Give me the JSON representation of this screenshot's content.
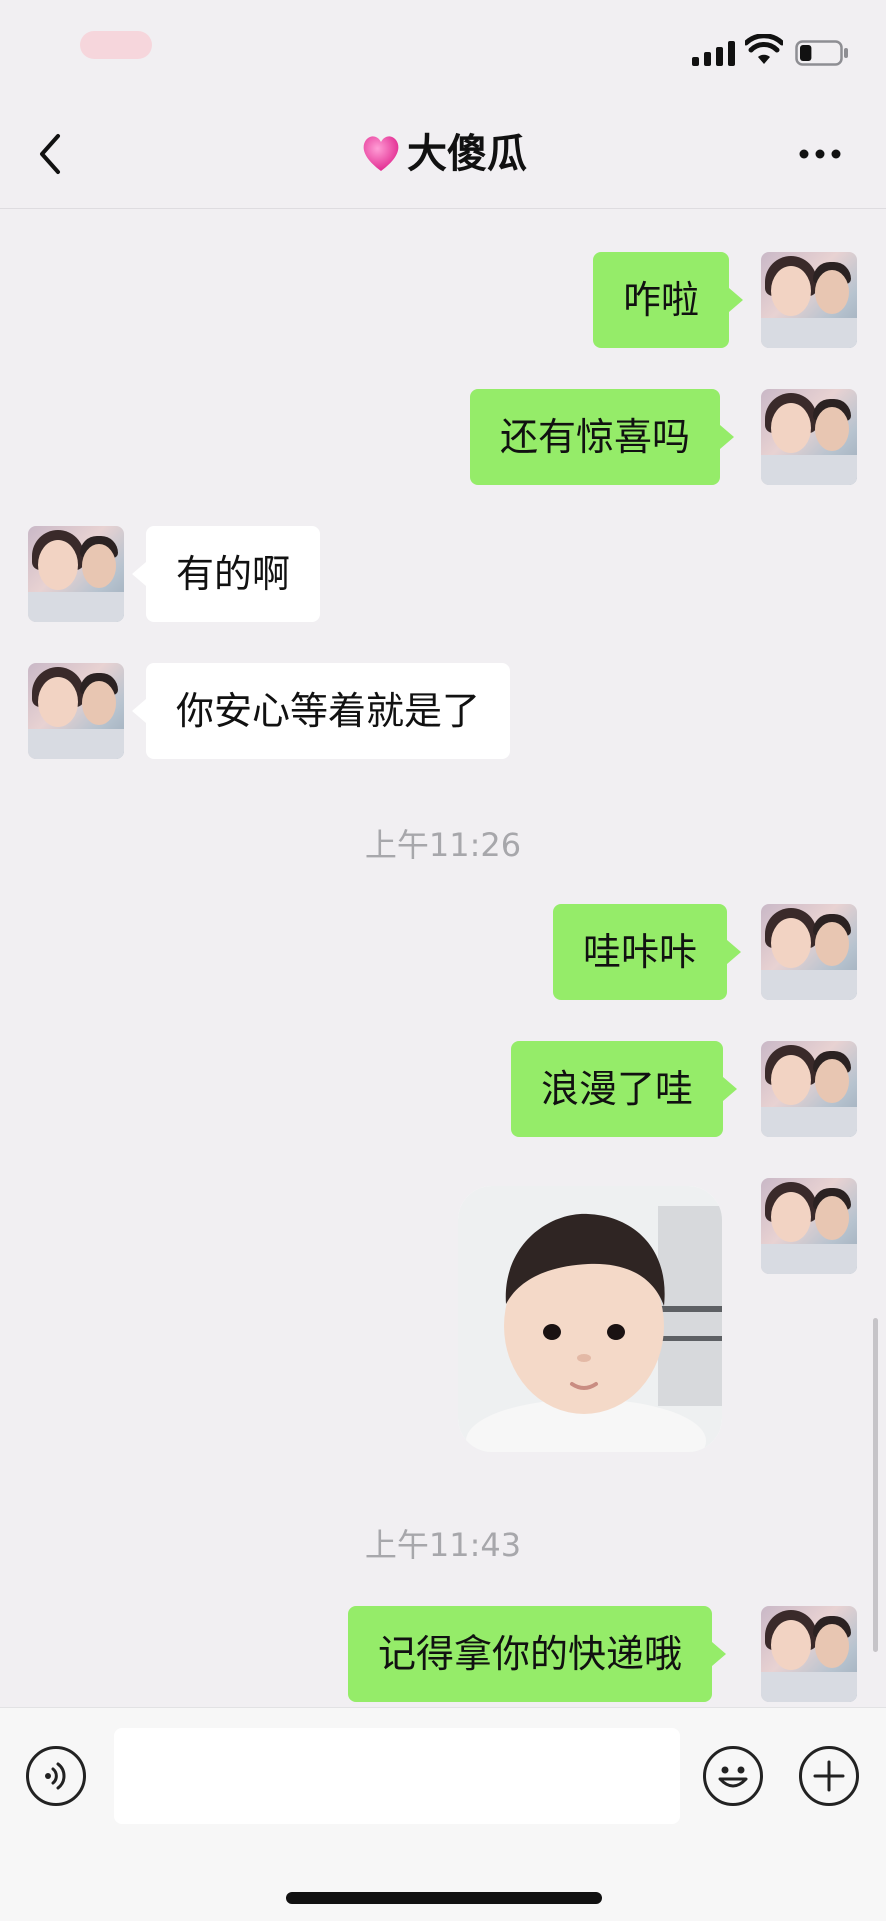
{
  "status_bar": {
    "signal": "signal-icon",
    "wifi": "wifi-icon",
    "battery_level": 0.3
  },
  "header": {
    "back_icon": "chevron-left-icon",
    "heart_icon": "pink-heart-icon",
    "title": "大傻瓜",
    "more_icon": "ellipsis-icon"
  },
  "messages": [
    {
      "from": "me",
      "text": "咋啦"
    },
    {
      "from": "me",
      "text": "还有惊喜吗"
    },
    {
      "from": "them",
      "text": "有的啊"
    },
    {
      "from": "them",
      "text": "你安心等着就是了"
    },
    {
      "type": "time",
      "text": "上午11:26"
    },
    {
      "from": "me",
      "text": "哇咔咔"
    },
    {
      "from": "me",
      "text": "浪漫了哇"
    },
    {
      "from": "me",
      "type": "sticker",
      "sticker": "baby-face-sticker"
    },
    {
      "type": "time",
      "text": "上午11:43"
    },
    {
      "from": "me",
      "text": "记得拿你的快递哦"
    }
  ],
  "input_bar": {
    "voice_icon": "voice-icon",
    "input_value": "",
    "emoji_icon": "emoji-icon",
    "plus_icon": "plus-icon"
  },
  "colors": {
    "my_bubble": "#95ec69",
    "their_bubble": "#ffffff",
    "background": "#f1eff2",
    "timestamp": "#a7a7ab"
  }
}
